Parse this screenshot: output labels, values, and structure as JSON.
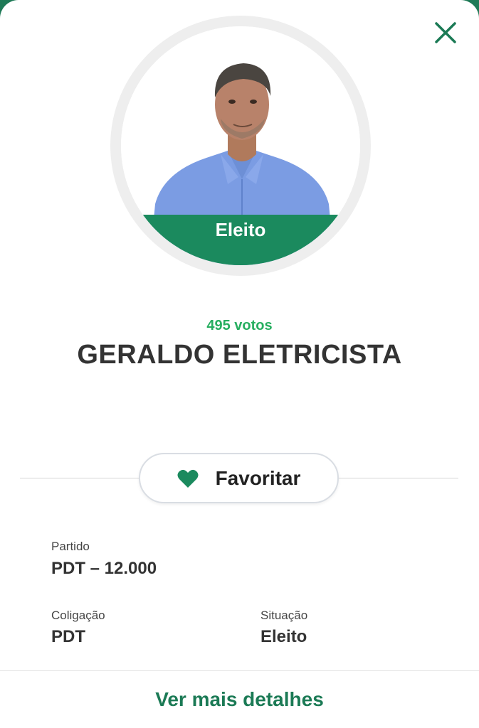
{
  "candidate": {
    "status_badge": "Eleito",
    "votes": "495 votos",
    "name": "GERALDO ELETRICISTA"
  },
  "actions": {
    "favorite_label": "Favoritar",
    "details_label": "Ver mais detalhes"
  },
  "info": {
    "partido_label": "Partido",
    "partido_value": "PDT – 12.000",
    "coligacao_label": "Coligação",
    "coligacao_value": "PDT",
    "situacao_label": "Situação",
    "situacao_value": "Eleito"
  },
  "icons": {
    "close": "close-icon",
    "favorite": "heart-icon"
  },
  "colors": {
    "accent_green": "#1b8a5e",
    "votes_green": "#27ae60",
    "link_green": "#1b7a55",
    "top_bar": "#1f7a57"
  }
}
